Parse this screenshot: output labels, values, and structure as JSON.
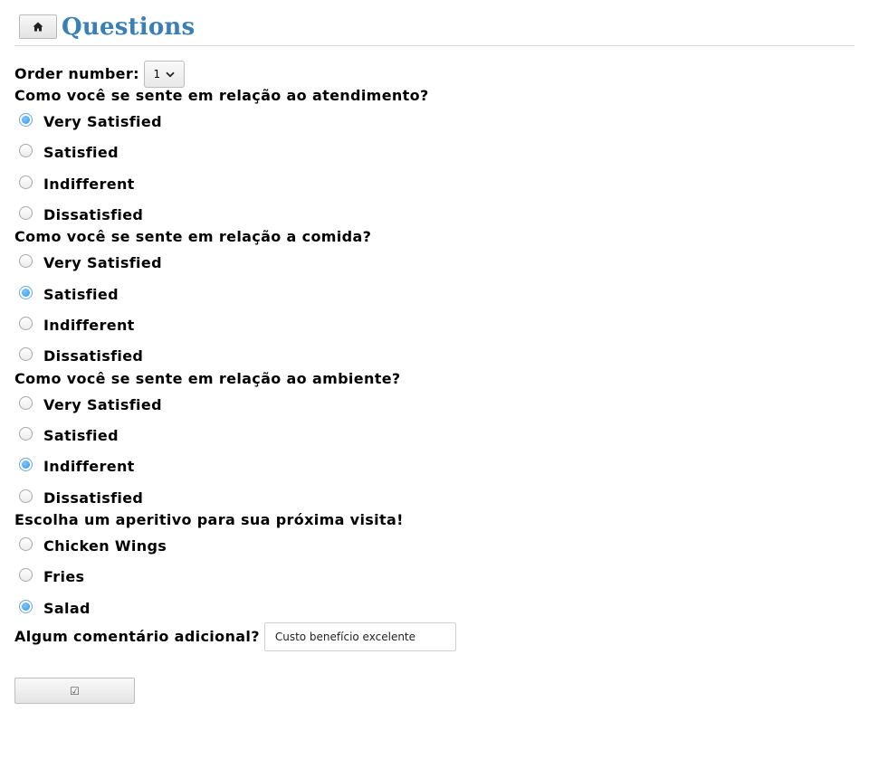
{
  "header": {
    "home_icon": "home-icon",
    "title": "Questions",
    "title_color": "#3a7fb5"
  },
  "order": {
    "label": "Order number:",
    "selected_value": "1"
  },
  "questions": [
    {
      "text": "Como você se sente em relação ao atendimento?",
      "options": [
        "Very Satisfied",
        "Satisfied",
        "Indifferent",
        "Dissatisfied"
      ],
      "selected": "Very Satisfied"
    },
    {
      "text": "Como você se sente em relação a comida?",
      "options": [
        "Very Satisfied",
        "Satisfied",
        "Indifferent",
        "Dissatisfied"
      ],
      "selected": "Satisfied"
    },
    {
      "text": "Como você se sente em relação ao ambiente?",
      "options": [
        "Very Satisfied",
        "Satisfied",
        "Indifferent",
        "Dissatisfied"
      ],
      "selected": "Indifferent"
    },
    {
      "text": "Escolha um aperitivo para sua próxima visita!",
      "options": [
        "Chicken Wings",
        "Fries",
        "Salad"
      ],
      "selected": "Salad"
    }
  ],
  "comment": {
    "label": "Algum comentário adicional?",
    "value": "Custo benefício excelente"
  },
  "submit": {
    "label": "☑"
  },
  "colors": {
    "radio_checked": "#2e96ee"
  }
}
